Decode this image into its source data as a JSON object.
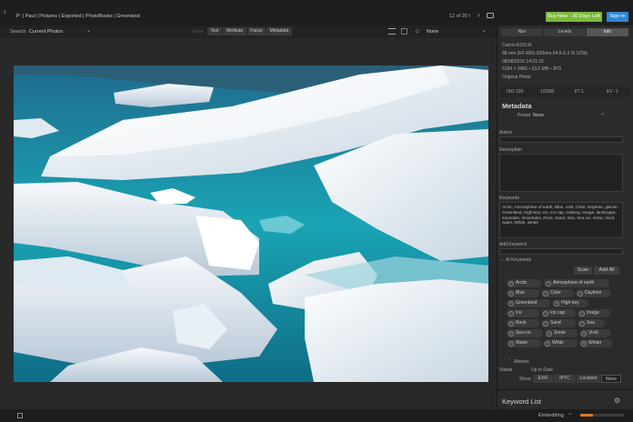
{
  "topbar": {
    "breadcrumb": "P: | Paul | Pictures | Exported | PhotoBooks | Greenland",
    "counter": "12 of 25",
    "buy_label": "Buy Now - 30 Days Left",
    "signin_label": "Sign-In"
  },
  "searchbar": {
    "search_label": "Search",
    "search_value": "Current Photos",
    "filters": [
      "None",
      "Text",
      "Attribute",
      "Faces",
      "Metadata"
    ],
    "sort_value": "None"
  },
  "panel_tabs": [
    "Nav",
    "Levels",
    "Info"
  ],
  "info": {
    "camera": "Canon EOS M",
    "lens": "88 mm (EF-M55-200mm f/4.5-6.3 IS STM)",
    "date": "08/08/2016 14:01:16",
    "dims": "5184 × 3456 • 10.0 MB • JPG",
    "source": "Original Photo",
    "iso": "ISO 100",
    "shutter": "1/2000",
    "aperture": "f/7.1",
    "ev": "EV -1"
  },
  "metadata": {
    "title": "Metadata",
    "preset_label": "Preset",
    "preset_value": "None",
    "author_label": "Author",
    "description_label": "Description",
    "keywords_label": "Keywords",
    "keywords_value": "Arctic, Atmosphere of earth, Blue, cold, Color, Daytime, glacier, Greenland, High-key, Ice, Ice cap, Iceberg, Image, landscape, mountain, mountains, Rock, Sand, Sea, Sea ice, snow, Vivid, water, White, winter",
    "add_keyword_label": "Add Keyword",
    "ai_keywords_label": "AI Keywords",
    "scan_label": "Scan",
    "add_all_label": "Add All",
    "ai_tags": [
      "Arctic",
      "Atmosphere of earth",
      "Blue",
      "Color",
      "Daytime",
      "Greenland",
      "High-key",
      "Ice",
      "Ice cap",
      "Image",
      "Rock",
      "Sand",
      "Sea",
      "Sea ice",
      "Snow",
      "Vivid",
      "Water",
      "White",
      "Winter"
    ],
    "albums_label": "Albums",
    "status_label": "Status",
    "status_value": "Up to Date",
    "show_label": "Show",
    "show_options": [
      "EXIF",
      "IPTC",
      "Location",
      "None"
    ]
  },
  "keyword_list": {
    "title": "Keyword List"
  },
  "bottombar": {
    "embedding_label": "Embedding",
    "progress": 0.3
  },
  "colors": {
    "buy": "#7cb83a",
    "signin": "#2f86d6",
    "accent": "#e07a2a"
  }
}
